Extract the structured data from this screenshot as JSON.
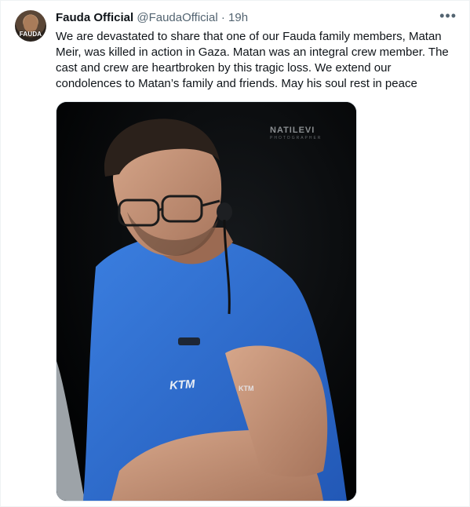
{
  "tweet": {
    "author_name": "Fauda Official",
    "handle": "@FaudaOfficial",
    "separator": "·",
    "time": "19h",
    "more_icon": "more-horizontal-icon",
    "avatar_text": "FAUDA",
    "text": "We are devastated to share that one of our Fauda family members, Matan Meir, was killed in action in Gaza. Matan was an integral crew member. The cast and crew are heartbroken by this tragic loss. We extend our condolences to Matan’s family and friends. May his soul rest in peace"
  },
  "media": {
    "watermark": "NATILEVI",
    "watermark_sub": "PHOTOGRAPHER",
    "shirt_text_left": "KTM",
    "shirt_text_right": "KTM"
  },
  "colors": {
    "text_primary": "#0f1419",
    "text_secondary": "#536471",
    "shirt_blue": "#2f6fd1",
    "photo_background": "#050607"
  }
}
